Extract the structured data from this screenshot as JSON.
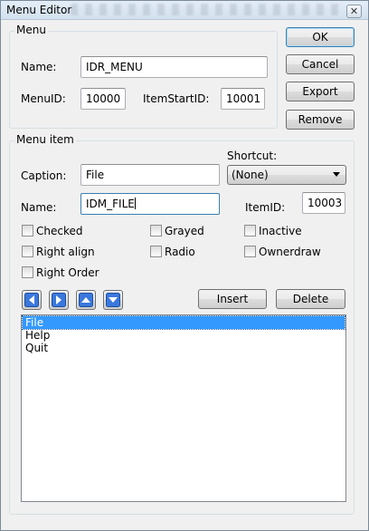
{
  "window": {
    "title": "Menu Editor",
    "close_glyph": "✕"
  },
  "menu_group": {
    "label": "Menu",
    "name_label": "Name:",
    "name_value": "IDR_MENU",
    "menuid_label": "MenuID:",
    "menuid_value": "10000",
    "itemstart_label": "ItemStartID:",
    "itemstart_value": "10001"
  },
  "buttons": {
    "ok": "OK",
    "cancel": "Cancel",
    "export": "Export",
    "remove": "Remove"
  },
  "item_group": {
    "label": "Menu item",
    "caption_label": "Caption:",
    "caption_value": "File",
    "shortcut_label": "Shortcut:",
    "shortcut_value": "(None)",
    "name_label": "Name:",
    "name_value": "IDM_FILE",
    "itemid_label": "ItemID:",
    "itemid_value": "10003",
    "checkboxes": {
      "checked": "Checked",
      "grayed": "Grayed",
      "inactive": "Inactive",
      "right_align": "Right align",
      "radio": "Radio",
      "ownerdraw": "Ownerdraw",
      "right_order": "Right Order"
    },
    "insert": "Insert",
    "delete": "Delete",
    "items": [
      {
        "label": "File",
        "selected": true
      },
      {
        "label": "Help",
        "selected": false
      },
      {
        "label": "Quit",
        "selected": false
      }
    ]
  },
  "icons": {
    "left": "left-arrow-icon",
    "right": "right-arrow-icon",
    "up": "up-arrow-icon",
    "down": "down-arrow-icon",
    "dropdown": "chevron-down-icon"
  },
  "colors": {
    "arrow_blue": "#2a64c8",
    "selection": "#3399ff",
    "focus_border": "#3c7fb1"
  }
}
